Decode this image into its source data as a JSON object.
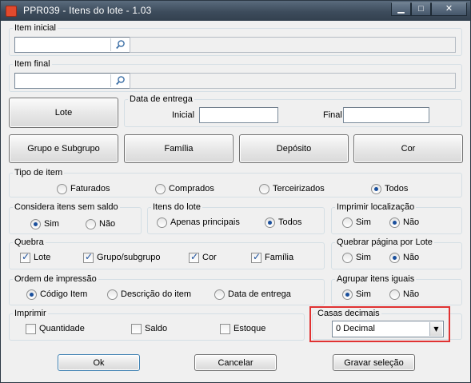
{
  "window": {
    "title": "PPR039 - Itens do lote - 1.03",
    "controls": {
      "minimize": "▁",
      "maximize": "□",
      "close": "✕"
    }
  },
  "item_inicial": {
    "label": "Item inicial",
    "value": "",
    "description": ""
  },
  "item_final": {
    "label": "Item final",
    "value": "",
    "description": ""
  },
  "buttons": {
    "lote": "Lote",
    "grupo_subgrupo": "Grupo e Subgrupo",
    "familia": "Família",
    "deposito": "Depósito",
    "cor": "Cor",
    "ok": "Ok",
    "cancelar": "Cancelar",
    "gravar": "Gravar seleção"
  },
  "data_entrega": {
    "label": "Data de entrega",
    "inicial_label": "Inicial",
    "inicial_value": "",
    "final_label": "Final",
    "final_value": ""
  },
  "tipo_item": {
    "label": "Tipo de item",
    "options": [
      "Faturados",
      "Comprados",
      "Terceirizados",
      "Todos"
    ],
    "selected": "Todos"
  },
  "considera_sem_saldo": {
    "label": "Considera itens sem saldo",
    "options": [
      "Sim",
      "Não"
    ],
    "selected": "Sim"
  },
  "itens_lote": {
    "label": "Itens do lote",
    "options": [
      "Apenas principais",
      "Todos"
    ],
    "selected": "Todos"
  },
  "imprimir_localizacao": {
    "label": "Imprimir localização",
    "options": [
      "Sim",
      "Não"
    ],
    "selected": "Não"
  },
  "quebra": {
    "label": "Quebra",
    "options": [
      "Lote",
      "Grupo/subgrupo",
      "Cor",
      "Família"
    ],
    "checked": [
      true,
      true,
      true,
      true
    ]
  },
  "quebrar_pagina": {
    "label": "Quebrar página por Lote",
    "options": [
      "Sim",
      "Não"
    ],
    "selected": "Não"
  },
  "ordem_impressao": {
    "label": "Ordem de impressão",
    "options": [
      "Código Item",
      "Descrição do item",
      "Data de entrega"
    ],
    "selected": "Código Item"
  },
  "agrupar_itens": {
    "label": "Agrupar itens iguais",
    "options": [
      "Sim",
      "Não"
    ],
    "selected": "Sim"
  },
  "imprimir": {
    "label": "Imprimir",
    "options": [
      "Quantidade",
      "Saldo",
      "Estoque"
    ],
    "checked": [
      false,
      false,
      false
    ]
  },
  "casas_decimais": {
    "label": "Casas decimais",
    "value": "0 Decimal"
  },
  "colors": {
    "highlight": "#e03232",
    "title_bar": "#3d4c5c"
  }
}
